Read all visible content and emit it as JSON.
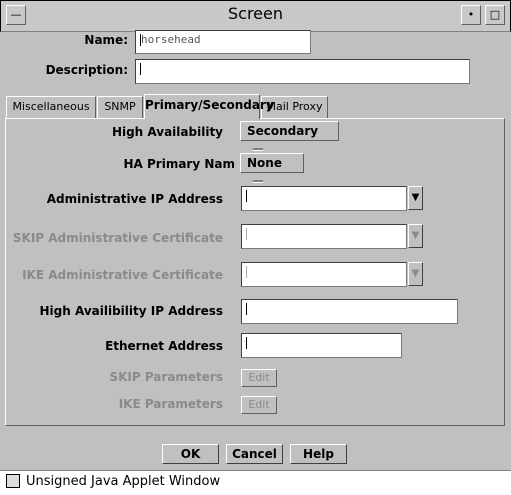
{
  "window": {
    "title": "Screen",
    "minimize_glyph": "•",
    "maximize_glyph": "□",
    "menu_glyph": "—"
  },
  "form": {
    "name_label": "Name:",
    "name_value": "horsehead",
    "description_label": "Description:",
    "description_value": ""
  },
  "tabs": [
    {
      "label": "Miscellaneous",
      "active": false
    },
    {
      "label": "SNMP",
      "active": false
    },
    {
      "label": "Primary/Secondary",
      "active": true
    },
    {
      "label": "Mail Proxy",
      "active": false
    }
  ],
  "panel": {
    "ha_label": "High Availability",
    "ha_value": "Secondary",
    "ha_primary_label": "HA Primary Nam",
    "ha_primary_value": "None",
    "admin_ip_label": "Administrative IP Address",
    "skip_cert_label": "SKIP Administrative Certificate",
    "ike_cert_label": "IKE Administrative Certificate",
    "ha_ip_label": "High Availibility IP Address",
    "ethernet_label": "Ethernet Address",
    "skip_params_label": "SKIP Parameters",
    "ike_params_label": "IKE Parameters",
    "edit_label": "Edit"
  },
  "buttons": {
    "ok": "OK",
    "cancel": "Cancel",
    "help": "Help"
  },
  "status": {
    "text": "Unsigned Java Applet Window"
  }
}
